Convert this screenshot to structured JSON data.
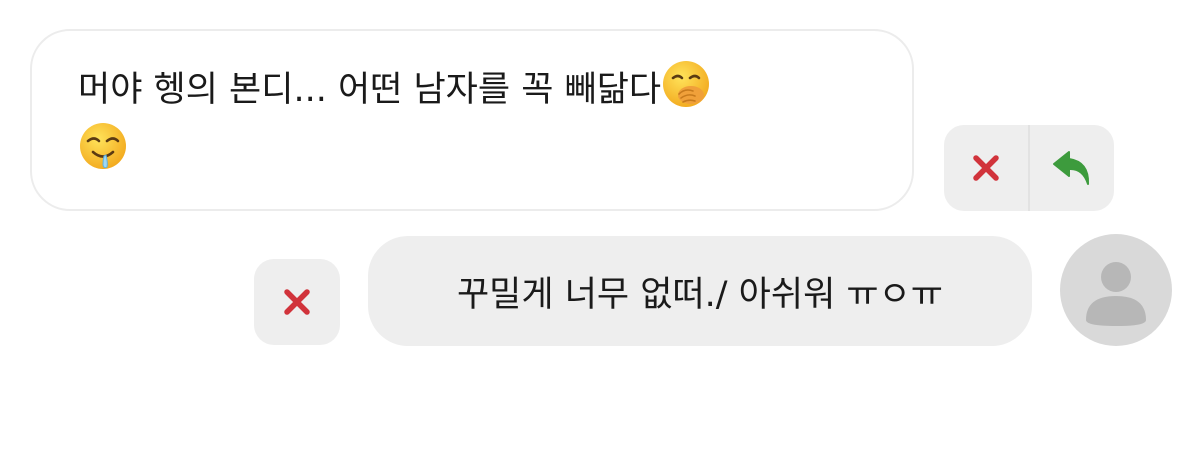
{
  "messages": [
    {
      "direction": "incoming",
      "line1": "머야 헹의 본디... 어떤 남자를 꼭 빼닮다",
      "line1_emoji": "face-with-hand-over-mouth-emoji",
      "line2_emoji": "drooling-face-emoji",
      "actions": [
        {
          "icon": "close-icon",
          "color": "#d1333b"
        },
        {
          "icon": "reply-arrow-icon",
          "color": "#3d9b3d"
        }
      ]
    },
    {
      "direction": "outgoing",
      "text": "꾸밀게 너무 없떠./ 아쉬워 ㅠㅇㅠ",
      "actions": [
        {
          "icon": "close-icon",
          "color": "#d1333b"
        }
      ],
      "avatar_icon": "default-user-avatar-icon"
    }
  ],
  "colors": {
    "bubble_incoming_bg": "#ffffff",
    "bubble_outgoing_bg": "#eeeeee",
    "action_bg": "#eeeeee",
    "avatar_bg": "#d9d9d9",
    "delete": "#d1333b",
    "reply": "#3d9b3d"
  }
}
